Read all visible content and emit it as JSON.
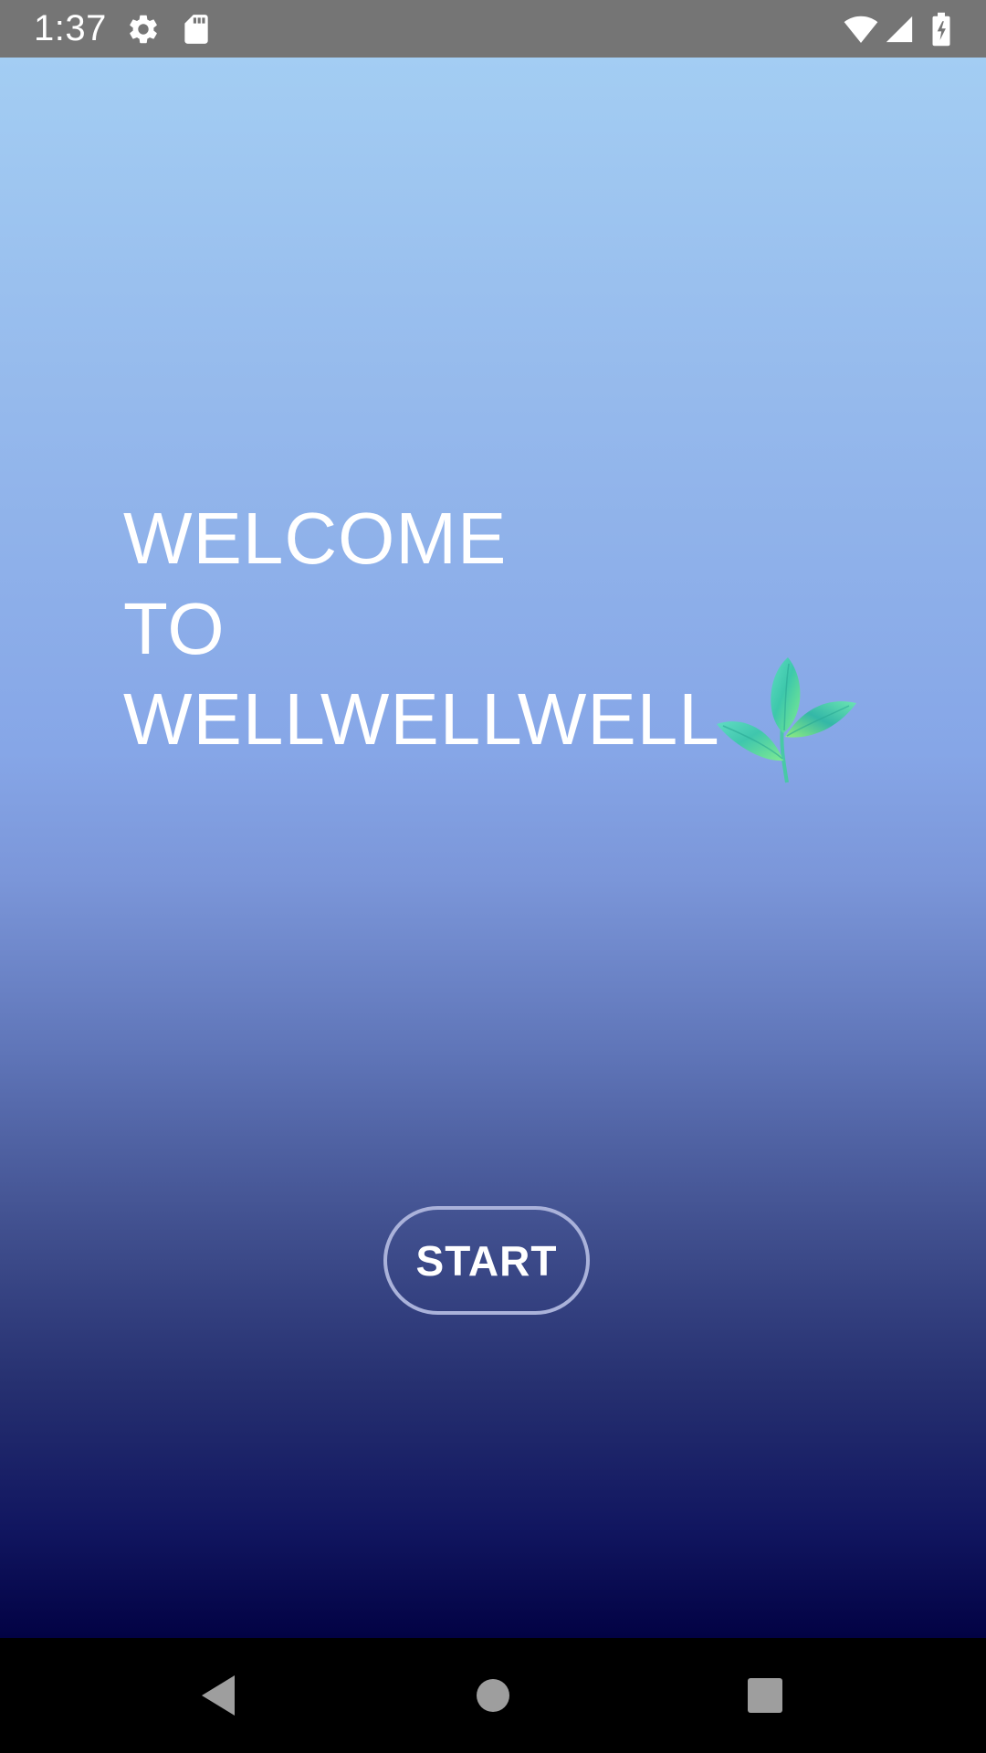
{
  "status_bar": {
    "time": "1:37",
    "icons": [
      "settings-gear-icon",
      "sd-card-icon",
      "wifi-icon",
      "cell-signal-icon",
      "battery-charging-icon"
    ]
  },
  "welcome": {
    "line1": "WELCOME",
    "line2": "TO",
    "line3": "WELLWELLWELL",
    "logo_icon": "leaf-icon"
  },
  "start_button": {
    "label": "START"
  },
  "nav_bar": {
    "icons": [
      "back-triangle-icon",
      "home-circle-icon",
      "recents-square-icon"
    ]
  },
  "colors": {
    "status_bar": "#757575",
    "gradient_top": "#a3cdf3",
    "gradient_bottom": "#020244",
    "button_border": "#aab2da",
    "leaf": "#4dd9a8"
  }
}
